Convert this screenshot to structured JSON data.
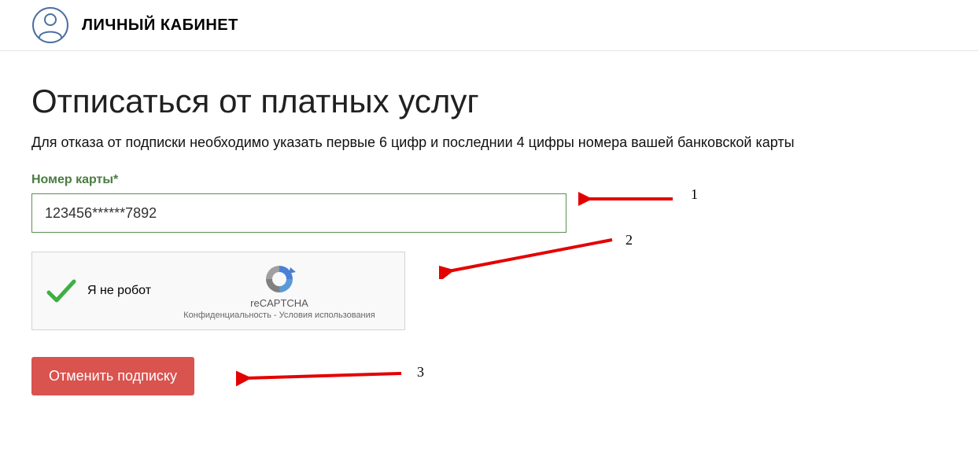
{
  "header": {
    "title": "ЛИЧНЫЙ КАБИНЕТ"
  },
  "page": {
    "title": "Отписаться от платных услуг",
    "instruction": "Для отказа от подписки необходимо указать первые 6 цифр и последнии 4 цифры номера вашей банковской карты"
  },
  "form": {
    "card_label": "Номер карты*",
    "card_value": "123456******7892"
  },
  "recaptcha": {
    "label": "Я не робот",
    "brand": "reCAPTCHA",
    "privacy": "Конфиденциальность",
    "terms": "Условия использования"
  },
  "submit": {
    "label": "Отменить подписку"
  },
  "annotations": {
    "n1": "1",
    "n2": "2",
    "n3": "3"
  }
}
